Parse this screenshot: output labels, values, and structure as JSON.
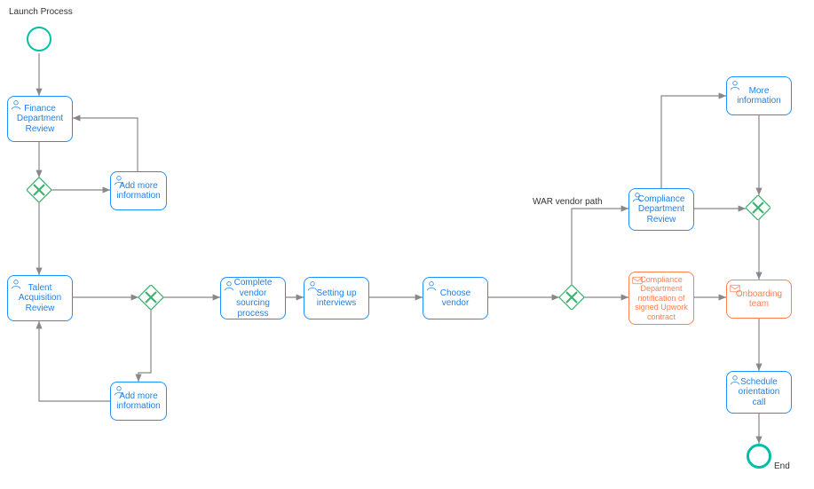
{
  "diagram": {
    "title": "Launch Process",
    "start_label": "Launch Process",
    "end_label": "End",
    "nodes": {
      "finance_review": "Finance Department Review",
      "talent_review": "Talent Acquisition Review",
      "add_info_finance": "Add more information",
      "add_info_talent": "Add more information",
      "complete_sourcing": "Complete vendor sourcing process",
      "setting_interviews": "Setting up interviews",
      "choose_vendor": "Choose vendor",
      "compliance_review": "Compliance Department Review",
      "compliance_notify": "Compliance Department notification of signed Upwork contract",
      "more_info": "More information",
      "onboarding_team": "Onboarding team",
      "schedule_call": "Schedule orientation call"
    },
    "edge_labels": {
      "war_vendor_path": "WAR vendor path"
    },
    "icons": {
      "user": "user-icon",
      "mail": "mail-icon"
    }
  }
}
